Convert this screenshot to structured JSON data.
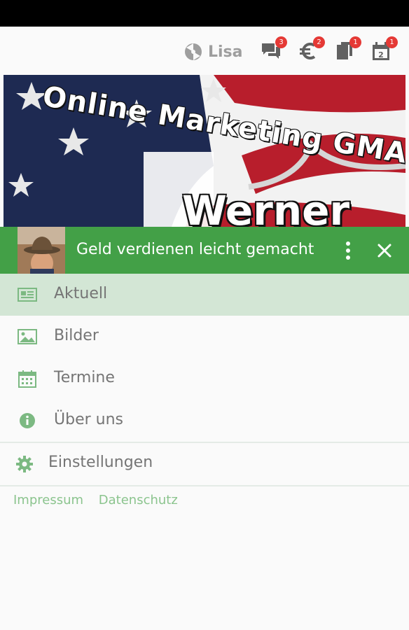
{
  "topbar": {
    "brand_name": "Lisa",
    "icons": [
      {
        "name": "chat-icon",
        "badge": "3"
      },
      {
        "name": "euro-icon",
        "badge": "2"
      },
      {
        "name": "documents-icon",
        "badge": "1"
      },
      {
        "name": "calendar-icon",
        "badge": "1"
      }
    ]
  },
  "hero": {
    "title_line1": "Online Marketing GMA",
    "title_line2": "Werner"
  },
  "header": {
    "title": "Geld verdienen leicht gemacht",
    "more_icon": "more-vert-icon",
    "close_icon": "close-icon"
  },
  "menu": {
    "items": [
      {
        "label": "Aktuell",
        "icon": "newspaper-icon",
        "active": true
      },
      {
        "label": "Bilder",
        "icon": "image-icon",
        "active": false
      },
      {
        "label": "Termine",
        "icon": "calendar-grid-icon",
        "active": false
      },
      {
        "label": "Über uns",
        "icon": "info-icon",
        "active": false
      }
    ],
    "settings_label": "Einstellungen"
  },
  "footer": {
    "impressum": "Impressum",
    "datenschutz": "Datenschutz"
  },
  "colors": {
    "accent": "#43a047",
    "active_bg": "#d3e6d5",
    "badge": "#e53935",
    "icon_green": "#7cb982",
    "link": "#8bc48e"
  }
}
